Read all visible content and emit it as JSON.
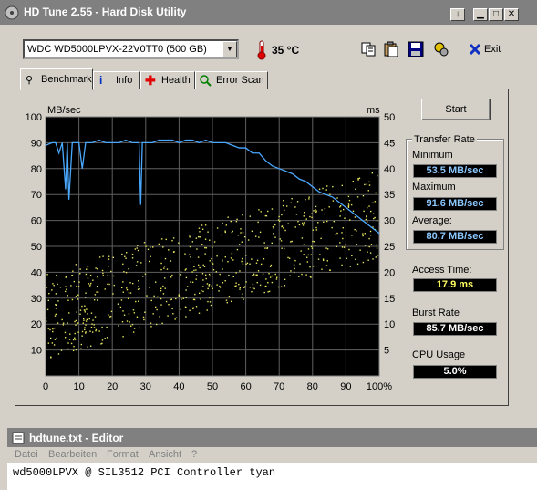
{
  "window": {
    "title": "HD Tune 2.55 - Hard Disk Utility",
    "min_glyph": "▁",
    "max_glyph": "□",
    "close_glyph": "✕",
    "help_glyph": "↓"
  },
  "toolbar": {
    "drive": "WDC WD5000LPVX-22V0TT0 (500 GB)",
    "temperature": "35 °C",
    "exit_label": "Exit"
  },
  "tabs": [
    {
      "label": "Benchmark",
      "icon": "benchmark-icon"
    },
    {
      "label": "Info",
      "icon": "info-icon"
    },
    {
      "label": "Health",
      "icon": "health-icon"
    },
    {
      "label": "Error Scan",
      "icon": "error-scan-icon"
    }
  ],
  "side": {
    "start_label": "Start",
    "transfer_rate_title": "Transfer Rate",
    "minimum_label": "Minimum",
    "minimum_value": "53.5 MB/sec",
    "maximum_label": "Maximum",
    "maximum_value": "91.6 MB/sec",
    "average_label": "Average:",
    "average_value": "80.7 MB/sec",
    "access_label": "Access Time:",
    "access_value": "17.9 ms",
    "burst_label": "Burst Rate",
    "burst_value": "85.7 MB/sec",
    "cpu_label": "CPU Usage",
    "cpu_value": "5.0%"
  },
  "chart_data": {
    "type": "line",
    "left_unit": "MB/sec",
    "right_unit": "ms",
    "y_left_ticks": [
      "100",
      "90",
      "80",
      "70",
      "60",
      "50",
      "40",
      "30",
      "20",
      "10"
    ],
    "y_right_ticks": [
      "50",
      "45",
      "40",
      "35",
      "30",
      "25",
      "20",
      "15",
      "10",
      "5"
    ],
    "x_ticks": [
      "0",
      "10",
      "20",
      "30",
      "40",
      "50",
      "60",
      "70",
      "80",
      "90",
      "100%"
    ],
    "xlim": [
      0,
      100
    ],
    "ylim_left": [
      0,
      100
    ],
    "ylim_right": [
      0,
      50
    ],
    "grid": true,
    "transfer_rate_series": {
      "x": [
        0,
        2,
        3,
        4,
        5,
        6,
        6.5,
        7,
        8,
        9,
        10,
        11,
        12,
        14,
        16,
        18,
        20,
        22,
        24,
        26,
        27,
        28,
        28.5,
        29,
        30,
        32,
        34,
        36,
        38,
        40,
        42,
        44,
        46,
        48,
        50,
        52,
        54,
        56,
        58,
        60,
        62,
        64,
        66,
        68,
        70,
        72,
        74,
        76,
        78,
        80,
        82,
        84,
        86,
        88,
        90,
        92,
        94,
        96,
        98,
        100
      ],
      "y": [
        89,
        90,
        90,
        86,
        90,
        72,
        90,
        68,
        90,
        90,
        90,
        80,
        90,
        90,
        91,
        90,
        90,
        90,
        91,
        90,
        90,
        90,
        66,
        90,
        90,
        90,
        91,
        91,
        91,
        90,
        91,
        91,
        90,
        91,
        90,
        90,
        90,
        89,
        88,
        88,
        86,
        86,
        83,
        81,
        80,
        79,
        78,
        76,
        75,
        73,
        71,
        70,
        69,
        67,
        65,
        63,
        61,
        59,
        57,
        55
      ]
    }
  },
  "editor": {
    "title": "hdtune.txt - Editor",
    "menu": [
      "Datei",
      "Bearbeiten",
      "Format",
      "Ansicht",
      "?"
    ],
    "content": "wd5000LPVX @ SIL3512 PCI Controller tyan"
  }
}
